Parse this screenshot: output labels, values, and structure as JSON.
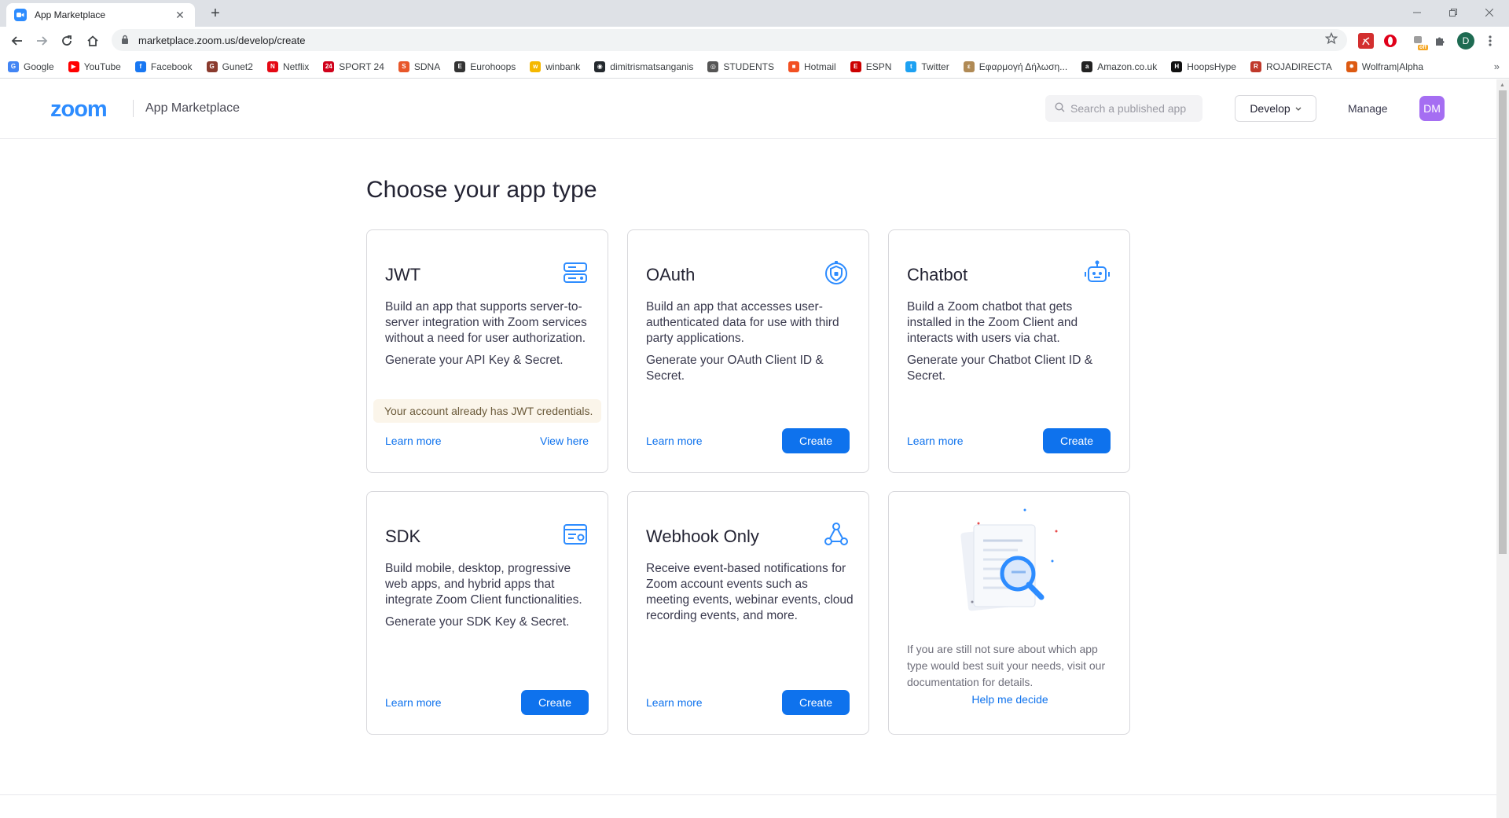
{
  "browser": {
    "tab_title": "App Marketplace",
    "tab_close": "✕",
    "new_tab": "+",
    "url": "marketplace.zoom.us/develop/create",
    "profile_initial": "D",
    "ext_badge": "off",
    "bookmarks": [
      {
        "label": "Google",
        "color": "#4285f4",
        "glyph": "G"
      },
      {
        "label": "YouTube",
        "color": "#ff0000",
        "glyph": "▶"
      },
      {
        "label": "Facebook",
        "color": "#1877f2",
        "glyph": "f"
      },
      {
        "label": "Gunet2",
        "color": "#8a3b2e",
        "glyph": "G"
      },
      {
        "label": "Netflix",
        "color": "#e50914",
        "glyph": "N"
      },
      {
        "label": "SPORT 24",
        "color": "#d0021b",
        "glyph": "24"
      },
      {
        "label": "SDNA",
        "color": "#e8572a",
        "glyph": "S"
      },
      {
        "label": "Eurohoops",
        "color": "#333333",
        "glyph": "E"
      },
      {
        "label": "winbank",
        "color": "#f5b800",
        "glyph": "w"
      },
      {
        "label": "dimitrismatsanganis",
        "color": "#24292e",
        "glyph": "◉"
      },
      {
        "label": "STUDENTS",
        "color": "#555555",
        "glyph": "◎"
      },
      {
        "label": "Hotmail",
        "color": "#f25022",
        "glyph": "■"
      },
      {
        "label": "ESPN",
        "color": "#cc0000",
        "glyph": "E"
      },
      {
        "label": "Twitter",
        "color": "#1da1f2",
        "glyph": "t"
      },
      {
        "label": "Εφαρμογή Δήλωση...",
        "color": "#b08a55",
        "glyph": "ε"
      },
      {
        "label": "Amazon.co.uk",
        "color": "#222222",
        "glyph": "a"
      },
      {
        "label": "HoopsHype",
        "color": "#111111",
        "glyph": "H"
      },
      {
        "label": "ROJADIRECTA",
        "color": "#c0392b",
        "glyph": "R"
      },
      {
        "label": "Wolfram|Alpha",
        "color": "#dd5a12",
        "glyph": "✹"
      }
    ],
    "more_bookmarks": "»"
  },
  "header": {
    "logo": "zoom",
    "app_name": "App Marketplace",
    "search_placeholder": "Search a published app",
    "develop_label": "Develop",
    "manage_label": "Manage",
    "avatar_initials": "DM",
    "accent": "#2d8cff",
    "avatar_color": "#a56ef2"
  },
  "page": {
    "title": "Choose your app type"
  },
  "cards": {
    "jwt": {
      "title": "JWT",
      "desc": "Build an app that supports server-to-server integration with Zoom services without a need for user authorization.",
      "generate": "Generate your API Key & Secret.",
      "notice": "Your account already has JWT credentials.",
      "learn": "Learn more",
      "view": "View here",
      "icon": "server-icon"
    },
    "oauth": {
      "title": "OAuth",
      "desc": "Build an app that accesses user-authenticated data for use with third party applications.",
      "generate": "Generate your OAuth Client ID & Secret.",
      "learn": "Learn more",
      "create": "Create",
      "icon": "shield-lock-icon"
    },
    "chatbot": {
      "title": "Chatbot",
      "desc": "Build a Zoom chatbot that gets installed in the Zoom Client and interacts with users via chat.",
      "generate": "Generate your Chatbot Client ID & Secret.",
      "learn": "Learn more",
      "create": "Create",
      "icon": "robot-icon"
    },
    "sdk": {
      "title": "SDK",
      "desc": "Build mobile, desktop, progressive web apps, and hybrid apps that integrate Zoom Client functionalities.",
      "generate": "Generate your SDK Key & Secret.",
      "learn": "Learn more",
      "create": "Create",
      "icon": "sdk-window-icon"
    },
    "webhook": {
      "title": "Webhook Only",
      "desc": "Receive event-based notifications for Zoom account events such as meeting events, webinar events, cloud recording events, and more.",
      "learn": "Learn more",
      "create": "Create",
      "icon": "webhook-icon"
    },
    "help": {
      "text": "If you are still not sure about which app type would best suit your needs, visit our documentation for details.",
      "link": "Help me decide",
      "icon": "document-search-illustration"
    }
  },
  "colors": {
    "primary_button": "#0e72ed",
    "link": "#0e72ed",
    "notice_bg": "#fbf5ea"
  }
}
